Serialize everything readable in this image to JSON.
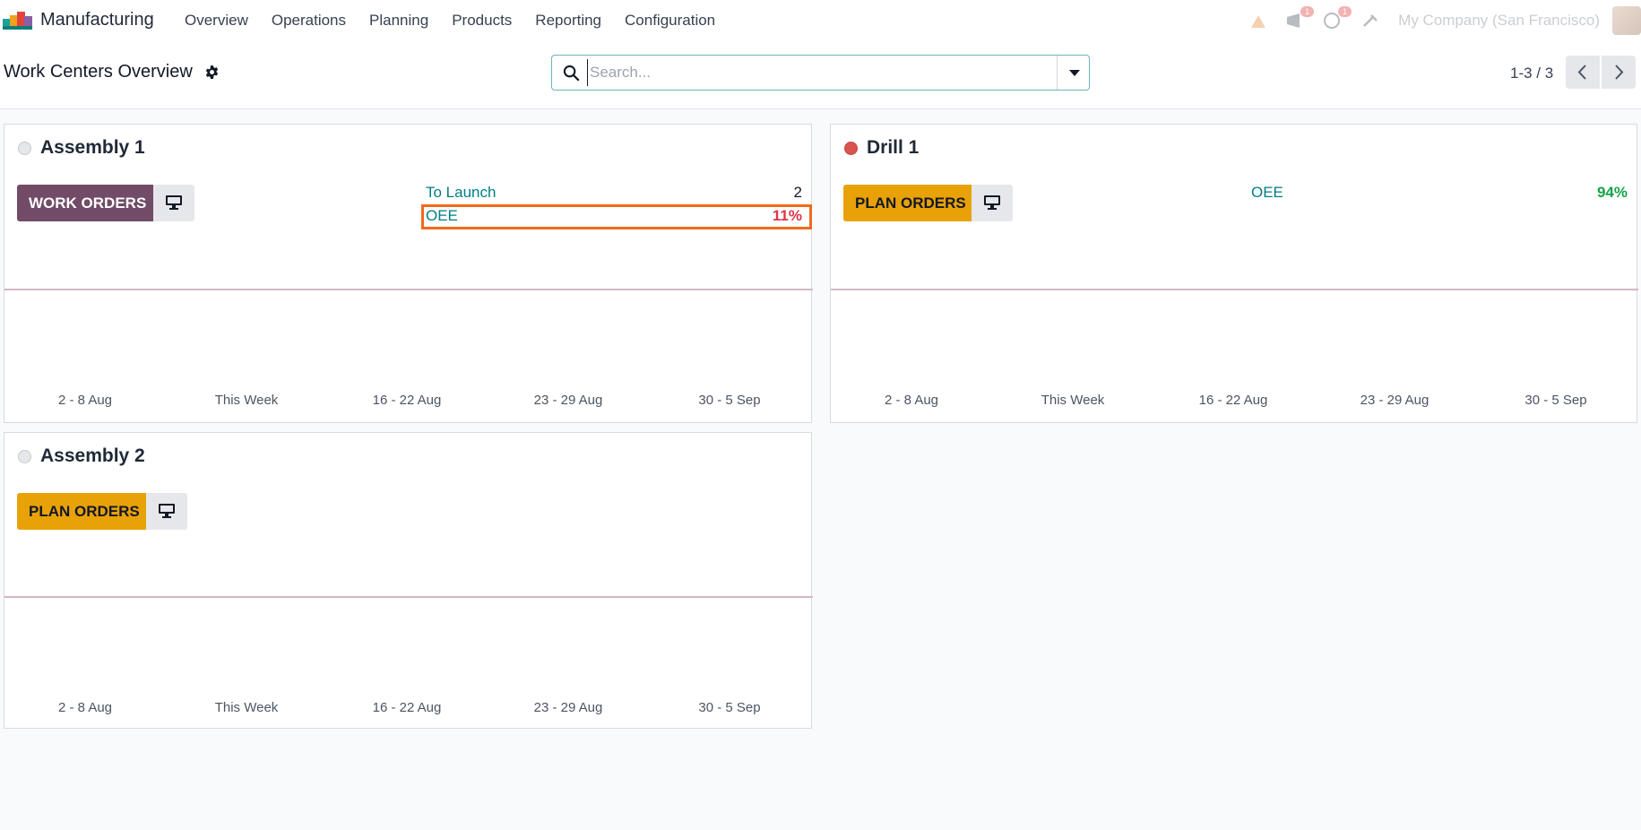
{
  "navbar": {
    "app_name": "Manufacturing",
    "menu": [
      "Overview",
      "Operations",
      "Planning",
      "Products",
      "Reporting",
      "Configuration"
    ],
    "systray": {
      "message_badge": "1",
      "activity_badge": "1",
      "company": "My Company (San Francisco)"
    }
  },
  "control_panel": {
    "title": "Work Centers Overview",
    "search_placeholder": "Search...",
    "pager": "1-3 / 3"
  },
  "cards": [
    {
      "name": "Assembly 1",
      "status": "gray",
      "button": "WORK ORDERS",
      "kpis": [
        {
          "label": "To Launch",
          "value": "2"
        },
        {
          "label": "OEE",
          "value": "11%"
        }
      ],
      "weeks": [
        "2 - 8 Aug",
        "This Week",
        "16 - 22 Aug",
        "23 - 29 Aug",
        "30 - 5 Sep"
      ]
    },
    {
      "name": "Drill 1",
      "status": "red",
      "button": "PLAN ORDERS",
      "kpis": [
        {
          "label": "OEE",
          "value": "94%"
        }
      ],
      "weeks": [
        "2 - 8 Aug",
        "This Week",
        "16 - 22 Aug",
        "23 - 29 Aug",
        "30 - 5 Sep"
      ]
    },
    {
      "name": "Assembly 2",
      "status": "gray",
      "button": "PLAN ORDERS",
      "kpis": [],
      "weeks": [
        "2 - 8 Aug",
        "This Week",
        "16 - 22 Aug",
        "23 - 29 Aug",
        "30 - 5 Sep"
      ]
    }
  ],
  "colors": {
    "accent_teal": "#017e84",
    "primary_purple": "#714b67",
    "plan_amber": "#e9a108",
    "oee_low": "#dc3545",
    "oee_high": "#16a34a",
    "highlight": "#f06a1d"
  }
}
